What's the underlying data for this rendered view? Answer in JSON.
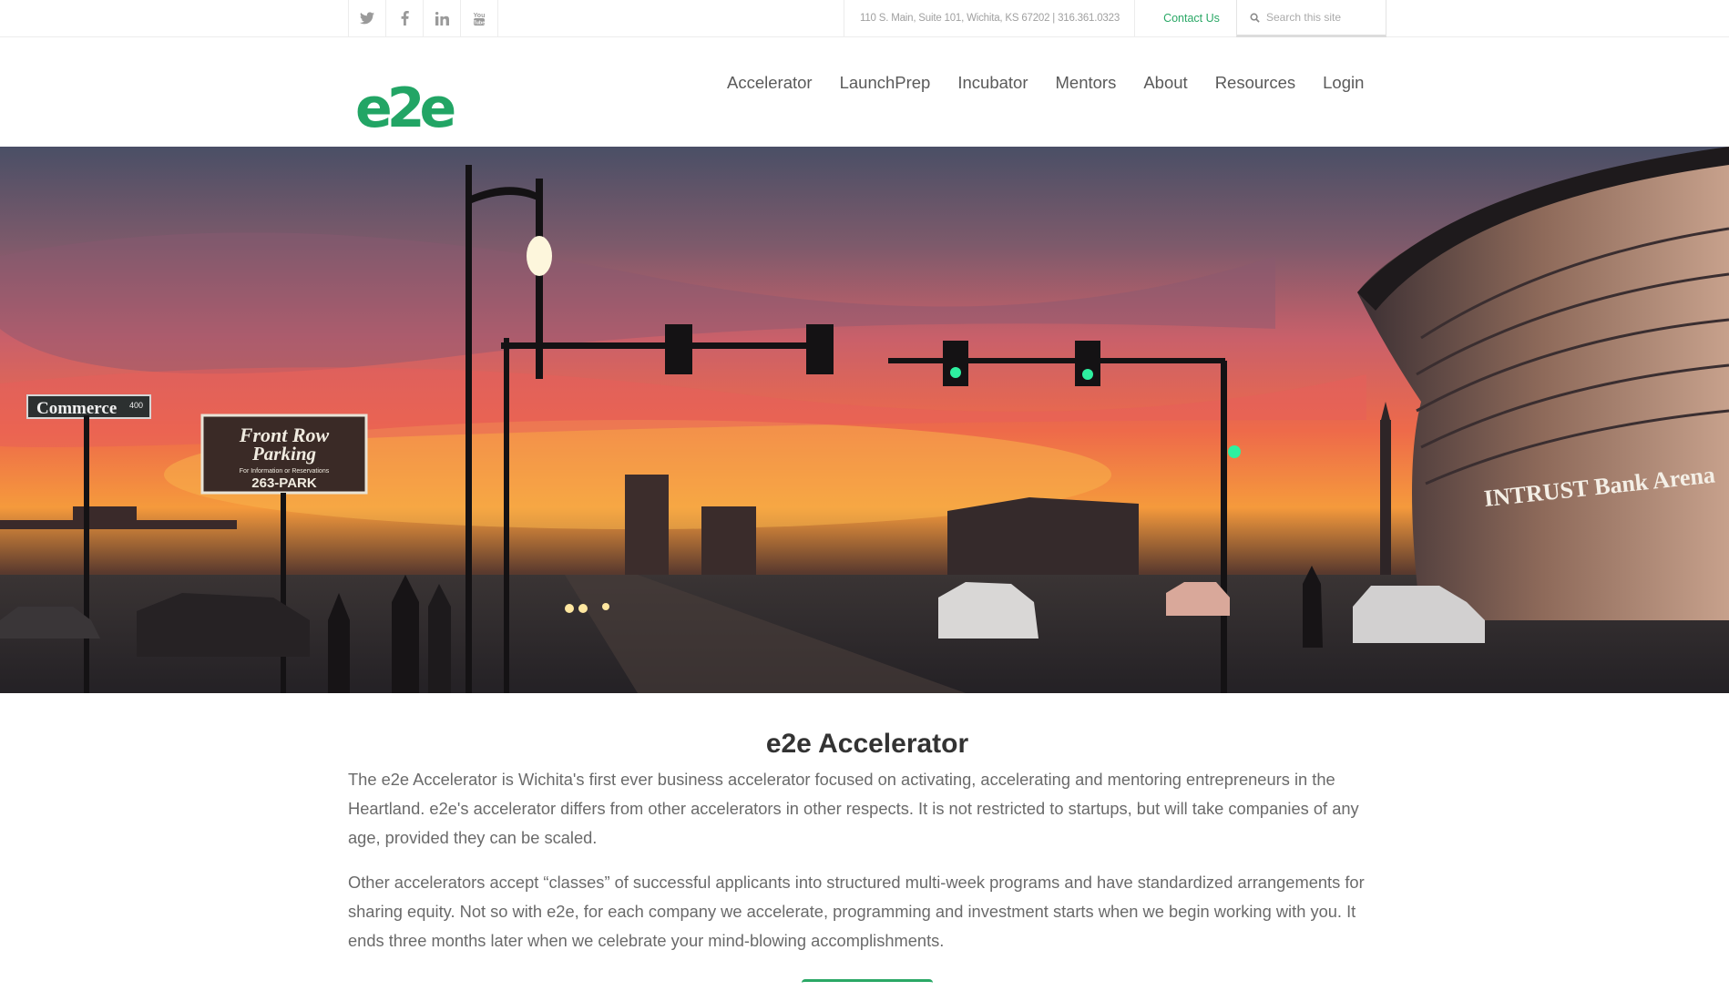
{
  "topbar": {
    "social": [
      {
        "icon": "twitter-icon"
      },
      {
        "icon": "facebook-icon"
      },
      {
        "icon": "linkedin-icon"
      },
      {
        "icon": "youtube-icon"
      }
    ],
    "address": "110 S. Main, Suite 101, Wichita, KS 67202 | 316.361.0323",
    "contact_label": "Contact Us",
    "search_placeholder": "Search this site"
  },
  "header": {
    "logo_text": "e2e",
    "nav": [
      "Accelerator",
      "LaunchPrep",
      "Incubator",
      "Mentors",
      "About",
      "Resources",
      "Login"
    ]
  },
  "hero": {
    "signs": {
      "street_sign": "Commerce",
      "street_number": "400",
      "parking_line1": "Front Row",
      "parking_line2": "Parking",
      "parking_small": "For Information or Reservations",
      "parking_phone": "263-PARK",
      "arena_sign": "INTRUST Bank Arena"
    }
  },
  "main": {
    "title": "e2e Accelerator",
    "paragraphs": [
      "The e2e Accelerator is Wichita's first ever business accelerator focused on activating, accelerating and mentoring entrepreneurs in the Heartland. e2e's accelerator differs from other accelerators in other respects. It is not restricted to startups, but will take companies of any age, provided they can be scaled.",
      "Other accelerators accept “classes” of successful applicants into structured multi-week programs and have standardized arrangements for sharing equity. Not so with e2e, for each company we accelerate, programming and investment starts when we begin working with you. It ends three months later when we celebrate your mind-blowing accomplishments."
    ]
  },
  "colors": {
    "brand_green": "#2aa866",
    "text_gray": "#6a6a6a",
    "sky_orange": "#f0763a"
  }
}
